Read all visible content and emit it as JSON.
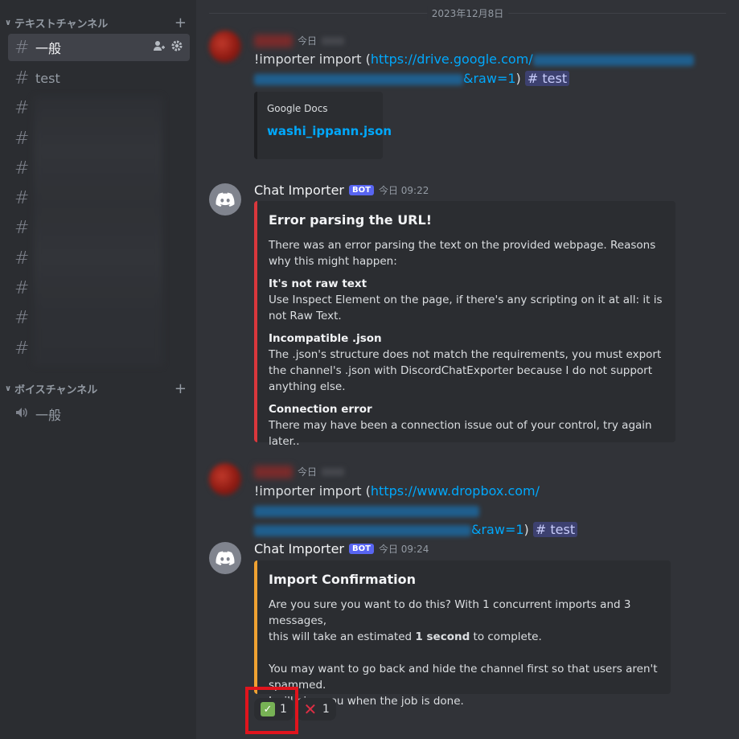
{
  "sidebar": {
    "text_category": "テキストチャンネル",
    "voice_category": "ボイスチャンネル",
    "channels": [
      {
        "name": "一般"
      },
      {
        "name": "test"
      }
    ],
    "voice_channels": [
      {
        "name": "一般"
      }
    ]
  },
  "main": {
    "date_divider": "2023年12月8日",
    "messages": [
      {
        "type": "user",
        "timestamp": "今日",
        "text_prefix": "!importer import (",
        "link": "https://drive.google.com/",
        "text_suffix": "&raw=1",
        "close_paren": ")",
        "mention": "# test",
        "embed": {
          "provider": "Google Docs",
          "title": "washi_ippann.json"
        }
      },
      {
        "type": "bot",
        "author": "Chat Importer",
        "bot_tag": "BOT",
        "timestamp": "今日 09:22",
        "embed": {
          "title": "Error parsing the URL!",
          "description": "There was an error parsing the text on the provided webpage. Reasons why this might happen:",
          "fields": [
            {
              "name": "It's not raw text",
              "value": "Use Inspect Element on the page, if there's any scripting on it at all: it is not Raw Text."
            },
            {
              "name": "Incompatible .json",
              "value": "The .json's structure does not match the requirements, you must export the channel's .json with DiscordChatExporter because I do not support anything else."
            },
            {
              "name": "Connection error",
              "value": "There may have been a connection issue out of your control, try again later.."
            }
          ],
          "color": "#da373c"
        }
      },
      {
        "type": "user",
        "timestamp": "今日",
        "text_prefix": "!importer import (",
        "link": "https://www.dropbox.com/",
        "text_suffix": "&raw=1",
        "close_paren": ")",
        "mention": "# test"
      },
      {
        "type": "bot",
        "author": "Chat Importer",
        "bot_tag": "BOT",
        "timestamp": "今日 09:24",
        "embed": {
          "title": "Import Confirmation",
          "line1": "Are you sure you want to do this? With 1 concurrent imports and 3 messages,",
          "line2_pre": "this will take an estimated ",
          "line2_bold": "1 second",
          "line2_post": " to complete.",
          "line3": "You may want to go back and hide the channel first so that users aren't spammed.",
          "line4": "I will ping you when the job is done.",
          "color": "#f0a232"
        },
        "reactions": [
          {
            "emoji": "check-mark",
            "count": "1"
          },
          {
            "emoji": "cross-mark",
            "count": "1"
          }
        ]
      }
    ]
  }
}
